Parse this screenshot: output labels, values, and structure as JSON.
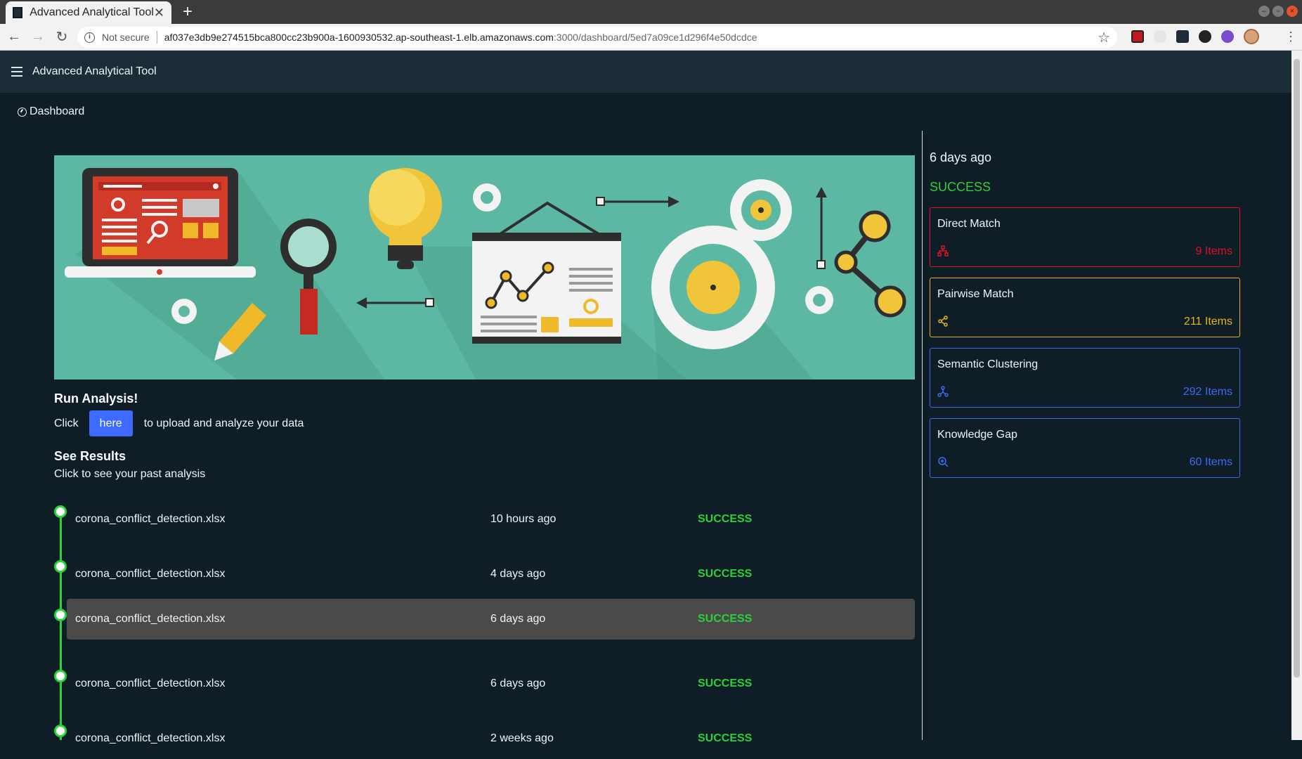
{
  "browser": {
    "tab_title": "Advanced Analytical Tool",
    "security_label": "Not secure",
    "url_host": "af037e3db9e274515bca800cc23b900a-1600930532.ap-southeast-1.elb.amazonaws.com",
    "url_path": ":3000/dashboard/5ed7a09ce1d296f4e50dcdce"
  },
  "app": {
    "title": "Advanced Analytical Tool",
    "breadcrumb": "Dashboard"
  },
  "run": {
    "title": "Run Analysis!",
    "prefix": "Click",
    "button_label": "here",
    "suffix": "to upload and analyze your data"
  },
  "results": {
    "title": "See Results",
    "subtitle": "Click to see your past analysis",
    "items": [
      {
        "file": "corona_conflict_detection.xlsx",
        "time": "10 hours ago",
        "status": "SUCCESS"
      },
      {
        "file": "corona_conflict_detection.xlsx",
        "time": "4 days ago",
        "status": "SUCCESS"
      },
      {
        "file": "corona_conflict_detection.xlsx",
        "time": "6 days ago",
        "status": "SUCCESS"
      },
      {
        "file": "corona_conflict_detection.xlsx",
        "time": "6 days ago",
        "status": "SUCCESS"
      },
      {
        "file": "corona_conflict_detection.xlsx",
        "time": "2 weeks ago",
        "status": "SUCCESS"
      }
    ],
    "selected_index": 2
  },
  "detail": {
    "time": "6 days ago",
    "status": "SUCCESS",
    "cards": [
      {
        "title": "Direct Match",
        "count": "9 Items",
        "icon": "sitemap-icon",
        "color": "#e0102a"
      },
      {
        "title": "Pairwise Match",
        "count": "211 Items",
        "icon": "share-icon",
        "color": "#e8b21f"
      },
      {
        "title": "Semantic Clustering",
        "count": "292 Items",
        "icon": "cluster-icon",
        "color": "#3a6cf0"
      },
      {
        "title": "Knowledge Gap",
        "count": "60 Items",
        "icon": "search-plus-icon",
        "color": "#3a6cf0"
      }
    ]
  },
  "colors": {
    "background": "#0f1e26",
    "appbar": "#1b2d36",
    "success": "#2bd138",
    "primary_button": "#3e6bff",
    "hero": "#5cb8a2"
  }
}
